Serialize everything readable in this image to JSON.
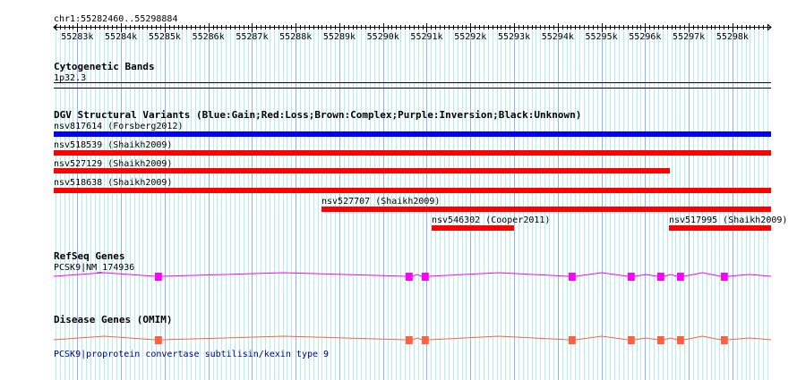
{
  "view": {
    "chrom": "chr1",
    "start": 55282460,
    "end": 55298884,
    "location_label": "chr1:55282460..55298884"
  },
  "ruler": {
    "ticks": [
      "55283k",
      "55284k",
      "55285k",
      "55286k",
      "55287k",
      "55288k",
      "55289k",
      "55290k",
      "55291k",
      "55292k",
      "55293k",
      "55294k",
      "55295k",
      "55296k",
      "55297k",
      "55298k"
    ]
  },
  "colors": {
    "grid_minor": "#b0eef4",
    "grid_major": "#88b8f0",
    "gain": "#0000ff",
    "loss": "#ff0000",
    "refseq": "#ff00ff",
    "omim": "#ff6040"
  },
  "tracks": {
    "cyto": {
      "title": "Cytogenetic Bands",
      "band": "1p32.3"
    },
    "dgv": {
      "title": "DGV Structural Variants (Blue:Gain;Red:Loss;Brown:Complex;Purple:Inversion;Black:Unknown)",
      "items": [
        {
          "label": "nsv817614 (Forsberg2012)",
          "type": "gain",
          "start": 55282460,
          "end": 55298884
        },
        {
          "label": "nsv518539 (Shaikh2009)",
          "type": "loss",
          "start": 55282460,
          "end": 55298884
        },
        {
          "label": "nsv527129 (Shaikh2009)",
          "type": "loss",
          "start": 55282460,
          "end": 55296567
        },
        {
          "label": "nsv518638 (Shaikh2009)",
          "type": "loss",
          "start": 55282460,
          "end": 55298884
        },
        {
          "label": "nsv527707 (Shaikh2009)",
          "type": "loss",
          "start": 55288591,
          "end": 55298884
        },
        {
          "label": "nsv546302 (Cooper2011)",
          "type": "loss",
          "start": 55291113,
          "end": 55292999
        },
        {
          "label": "nsv517995 (Shaikh2009)",
          "type": "loss",
          "start": 55296546,
          "end": 55298884
        }
      ]
    },
    "refseq": {
      "title": "RefSeq Genes",
      "gene_label": "PCSK9|NM_174936"
    },
    "omim": {
      "title": "Disease Genes (OMIM)",
      "gene_label": "PCSK9|proprotein convertase subtilisin/kexin type 9"
    },
    "exons": [
      55284777,
      55290518,
      55290887,
      55294250,
      55295603,
      55296280,
      55296731,
      55297736
    ]
  }
}
